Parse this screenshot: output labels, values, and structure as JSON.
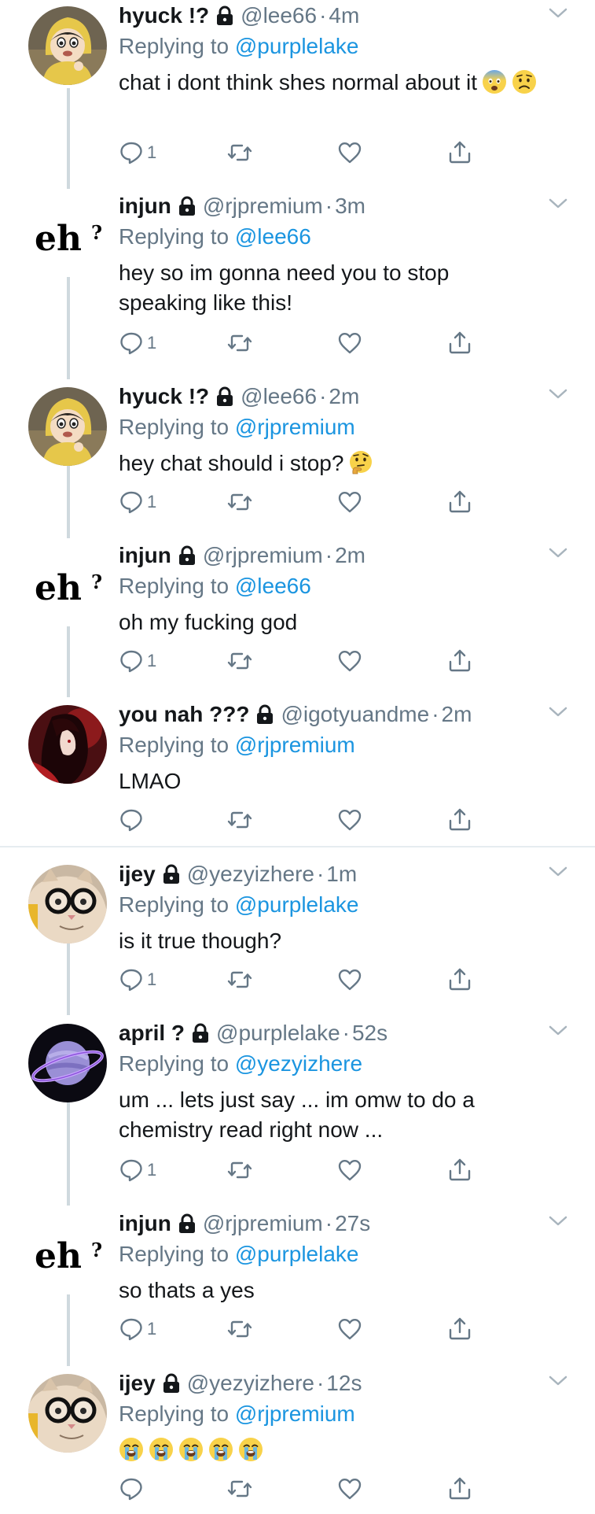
{
  "colors": {
    "accent": "#1b95e0",
    "muted": "#657786",
    "text": "#14171a",
    "thread": "#cfd9de"
  },
  "tweets": [
    {
      "name": "hyuck !?",
      "handle": "@lee66",
      "sep": "·",
      "time": "4m",
      "reply_prefix": "Replying to",
      "reply_to": "@purplelake",
      "text": "chat i dont think shes normal about it",
      "emojis": [
        "anxious-face",
        "worried-face"
      ],
      "reply_count": "1",
      "avatar": "cartoon-boy-avatar"
    },
    {
      "name": "injun",
      "handle": "@rjpremium",
      "sep": "·",
      "time": "3m",
      "reply_prefix": "Replying to",
      "reply_to": "@lee66",
      "text": "hey so im gonna need you to stop\nspeaking like this!",
      "emojis": [],
      "reply_count": "1",
      "avatar": "eh-text-avatar",
      "avatar_text": "eh?"
    },
    {
      "name": "hyuck !?",
      "handle": "@lee66",
      "sep": "·",
      "time": "2m",
      "reply_prefix": "Replying to",
      "reply_to": "@rjpremium",
      "text": "hey chat should i stop?",
      "emojis": [
        "thinking-face"
      ],
      "reply_count": "1",
      "avatar": "cartoon-boy-avatar"
    },
    {
      "name": "injun",
      "handle": "@rjpremium",
      "sep": "·",
      "time": "2m",
      "reply_prefix": "Replying to",
      "reply_to": "@lee66",
      "text": "oh my fucking god",
      "emojis": [],
      "reply_count": "1",
      "avatar": "eh-text-avatar",
      "avatar_text": "eh?"
    },
    {
      "name": "you nah ???",
      "handle": "@igotyuandme",
      "sep": "·",
      "time": "2m",
      "reply_prefix": "Replying to",
      "reply_to": "@rjpremium",
      "text": "LMAO",
      "emojis": [],
      "reply_count": "",
      "avatar": "anime-red-avatar"
    },
    {
      "name": "ijey",
      "handle": "@yezyizhere",
      "sep": "·",
      "time": "1m",
      "reply_prefix": "Replying to",
      "reply_to": "@purplelake",
      "text": "is it true though?",
      "emojis": [],
      "reply_count": "1",
      "avatar": "cat-glasses-avatar"
    },
    {
      "name": "april ?",
      "handle": "@purplelake",
      "sep": "·",
      "time": "52s",
      "reply_prefix": "Replying to",
      "reply_to": "@yezyizhere",
      "text": "um ... lets just say ... im omw to do a\nchemistry read right now ...",
      "emojis": [],
      "reply_count": "1",
      "avatar": "purple-planet-avatar"
    },
    {
      "name": "injun",
      "handle": "@rjpremium",
      "sep": "·",
      "time": "27s",
      "reply_prefix": "Replying to",
      "reply_to": "@purplelake",
      "text": "so thats a yes",
      "emojis": [],
      "reply_count": "1",
      "avatar": "eh-text-avatar",
      "avatar_text": "eh?"
    },
    {
      "name": "ijey",
      "handle": "@yezyizhere",
      "sep": "·",
      "time": "12s",
      "reply_prefix": "Replying to",
      "reply_to": "@rjpremium",
      "text": "",
      "emojis": [
        "crying-face",
        "crying-face",
        "crying-face",
        "crying-face",
        "crying-face"
      ],
      "reply_count": "",
      "avatar": "cat-glasses-avatar"
    }
  ]
}
